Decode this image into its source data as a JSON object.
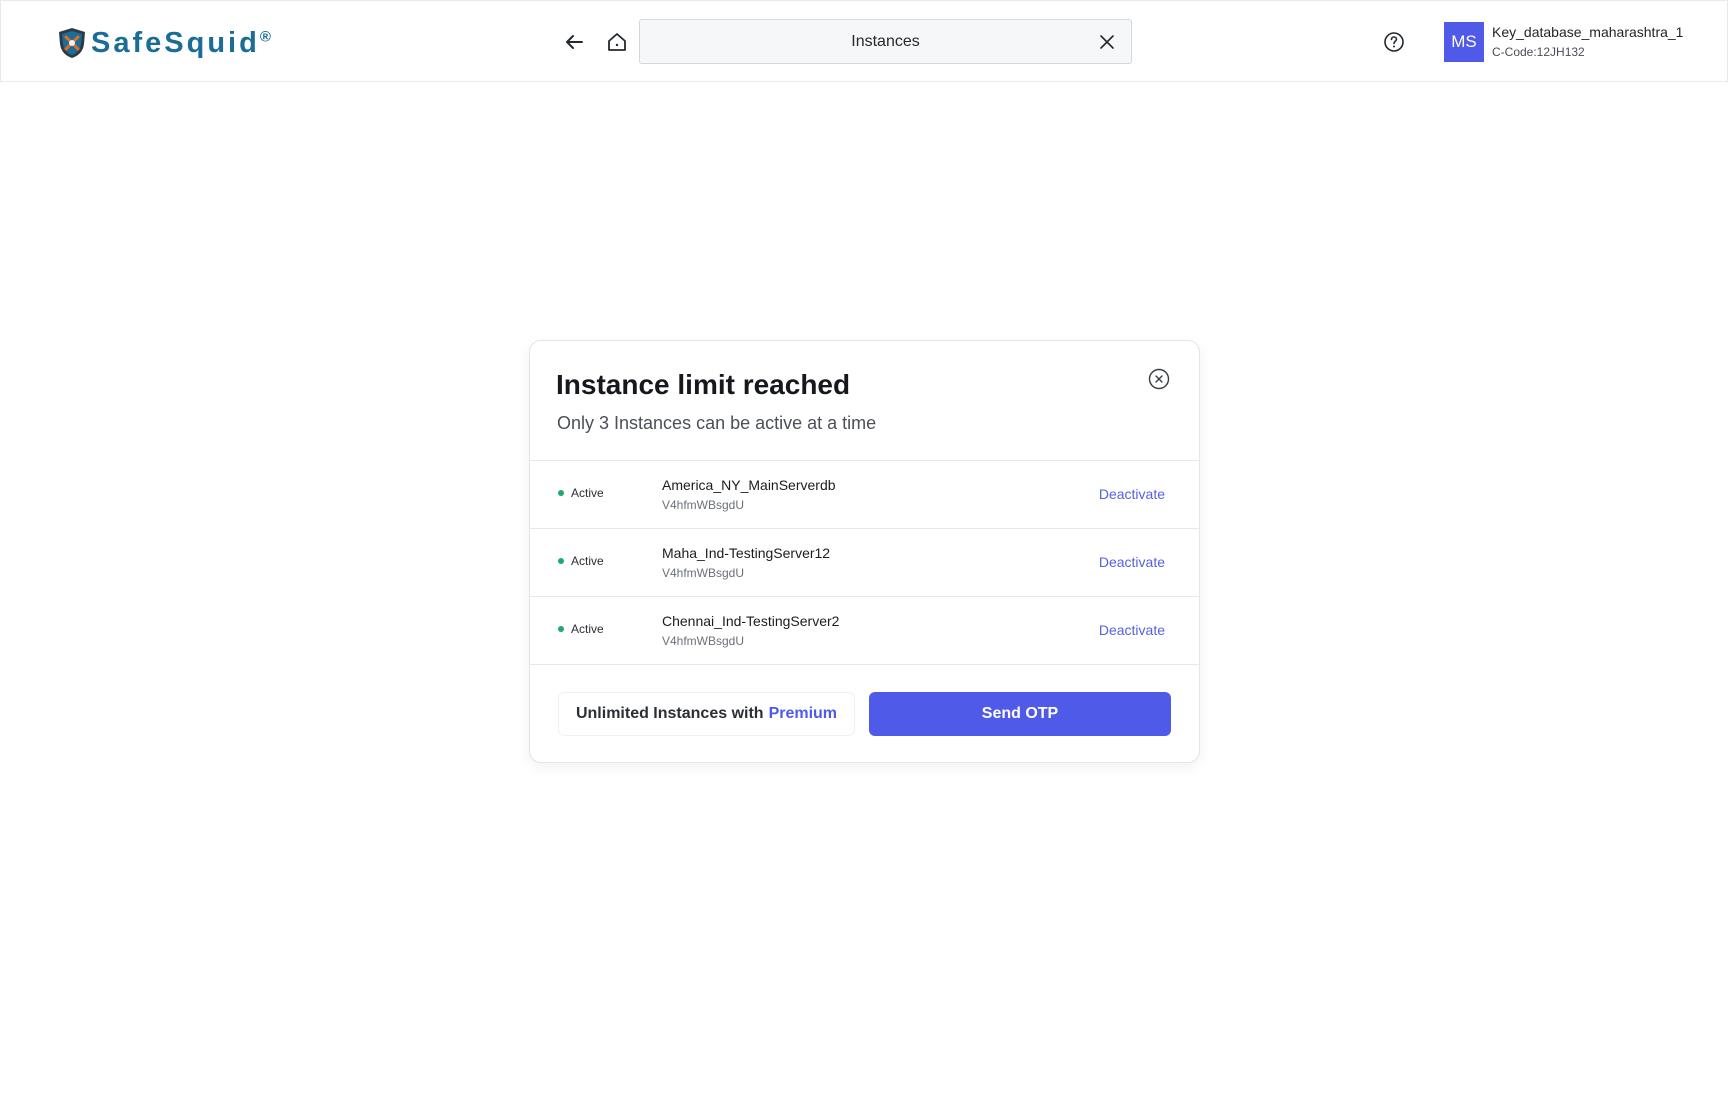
{
  "header": {
    "logo": {
      "text": "SafeSquid",
      "reg": "®"
    },
    "search": {
      "value": "Instances"
    },
    "user": {
      "initials": "MS",
      "name": "Key_database_maharashtra_1",
      "code": "C-Code:12JH132"
    },
    "icons": {
      "back": "arrow-left-icon",
      "home": "home-icon",
      "clear": "close-icon",
      "help": "help-icon"
    }
  },
  "modal": {
    "title": "Instance limit reached",
    "subtitle": "Only 3 Instances can be active at a time",
    "instances": [
      {
        "status": "Active",
        "name": "America_NY_MainServerdb",
        "id": "V4hfmWBsgdU",
        "action": "Deactivate"
      },
      {
        "status": "Active",
        "name": "Maha_Ind-TestingServer12",
        "id": "V4hfmWBsgdU",
        "action": "Deactivate"
      },
      {
        "status": "Active",
        "name": "Chennai_Ind-TestingServer2",
        "id": "V4hfmWBsgdU",
        "action": "Deactivate"
      }
    ],
    "premium": {
      "prefix": "Unlimited Instances with",
      "link": "Premium"
    },
    "send_otp": "Send OTP"
  },
  "colors": {
    "accent": "#4f5be8",
    "active": "#1fa971",
    "brand": "#1a6d96"
  }
}
